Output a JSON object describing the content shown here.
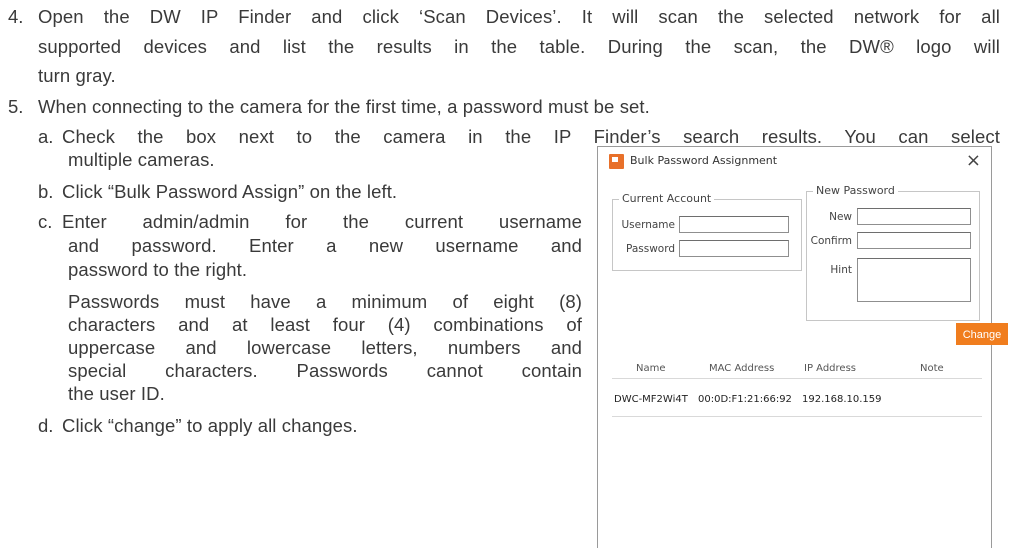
{
  "doc": {
    "step4": {
      "num": "4.",
      "lines": [
        "Open the DW IP Finder and click ‘Scan Devices’. It will scan the selected network for all",
        "supported devices and list the results in the table. During the scan, the DW® logo will",
        "turn gray."
      ]
    },
    "step5": {
      "num": "5.",
      "line": "When connecting to the camera for the first time, a password must be set."
    },
    "step5a": {
      "letter": "a.",
      "line1": "Check the box next to the camera in the IP Finder’s search results. You can select",
      "line2": "multiple cameras."
    },
    "step5b": {
      "letter": "b.",
      "line": "Click “Bulk Password Assign” on the left."
    },
    "step5c": {
      "letter": "c.",
      "line1": "Enter admin/admin for the current username",
      "line2": "and password. Enter a new username and",
      "line3": "password to the right."
    },
    "note": [
      "Passwords must have a minimum of eight (8)",
      "characters and at least four (4) combinations of",
      "uppercase and lowercase letters, numbers and",
      "special characters. Passwords cannot contain",
      "the user ID."
    ],
    "step5d": {
      "letter": "d.",
      "line": "Click “change” to apply all changes."
    }
  },
  "dialog": {
    "title": "Bulk Password Assignment",
    "close_glyph": "×",
    "current_account": {
      "label": "Current Account",
      "username_label": "Username",
      "password_label": "Password",
      "username_value": "",
      "password_value": ""
    },
    "new_password": {
      "label": "New Password",
      "new_label": "New",
      "confirm_label": "Confirm",
      "hint_label": "Hint"
    },
    "change_label": "Change",
    "table": {
      "headers": [
        "Name",
        "MAC Address",
        "IP Address",
        "Note"
      ],
      "rows": [
        [
          "DWC-MF2Wi4T",
          "00:0D:F1:21:66:92",
          "192.168.10.159",
          ""
        ]
      ]
    },
    "accent_color": "#f07d1e"
  }
}
